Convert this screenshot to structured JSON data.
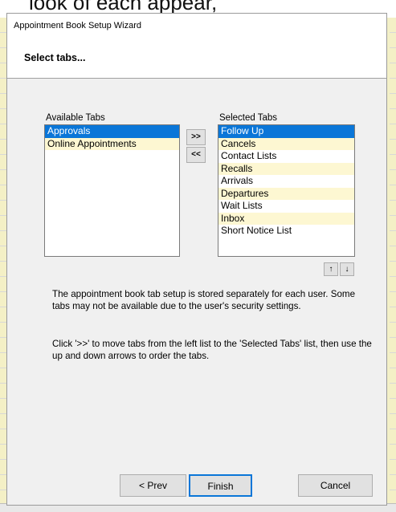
{
  "background": {
    "top_text": "look of each appear,"
  },
  "dialog": {
    "title": "Appointment Book Setup Wizard",
    "header": "Select tabs..."
  },
  "available": {
    "label": "Available Tabs",
    "items": [
      "Approvals",
      "Online Appointments"
    ],
    "selected_index": 0
  },
  "selected": {
    "label": "Selected Tabs",
    "items": [
      "Follow Up",
      "Cancels",
      "Contact Lists",
      "Recalls",
      "Arrivals",
      "Departures",
      "Wait Lists",
      "Inbox",
      "Short Notice List"
    ],
    "selected_index": 0
  },
  "buttons": {
    "add": ">>",
    "remove": "<<",
    "up": "↑",
    "down": "↓",
    "prev": "< Prev",
    "finish": "Finish",
    "cancel": "Cancel"
  },
  "info": {
    "paragraph1": "The appointment book tab setup is stored separately for each user. Some tabs may not be available due to the user's security settings.",
    "paragraph2": "Click '>>' to move tabs from the left list to the 'Selected Tabs' list, then use the up and down arrows to order the tabs."
  },
  "colors": {
    "selection": "#0a76d8",
    "alt_row": "#fdf7d2",
    "dialog_bg": "#f0f0f0"
  }
}
